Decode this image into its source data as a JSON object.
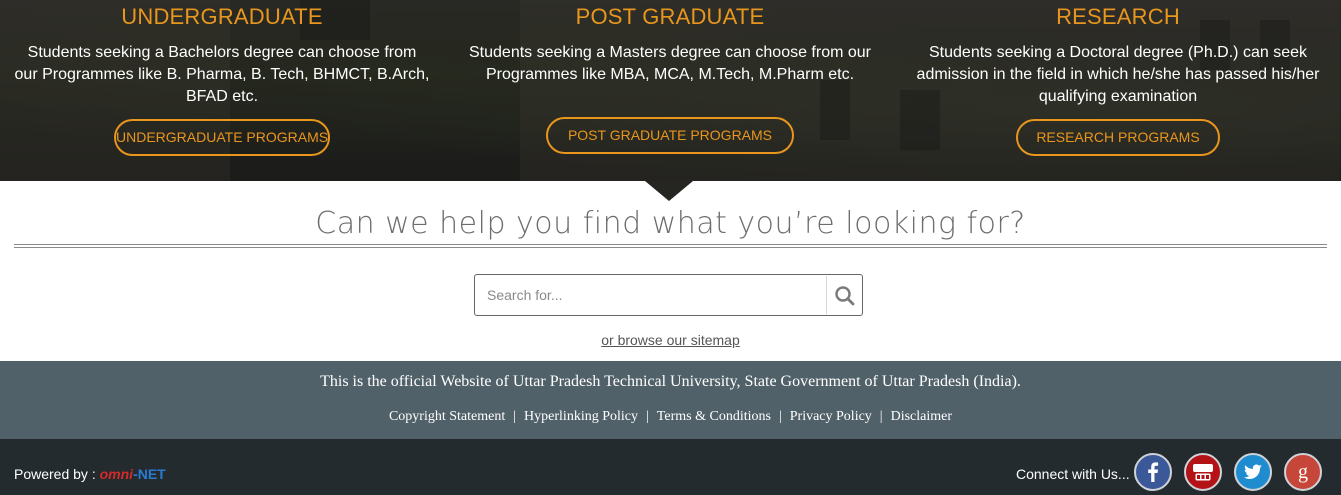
{
  "programs": {
    "undergraduate": {
      "title": "UNDERGRADUATE",
      "description": "Students seeking a Bachelors degree can choose from our Programmes like B. Pharma, B. Tech, BHMCT, B.Arch, BFAD etc.",
      "button": "UNDERGRADUATE PROGRAMS"
    },
    "postgraduate": {
      "title": "POST GRADUATE",
      "description": "Students seeking a Masters degree can choose from our Programmes like MBA, MCA, M.Tech, M.Pharm etc.",
      "button": "POST GRADUATE PROGRAMS"
    },
    "research": {
      "title": "RESEARCH",
      "description": "Students seeking a Doctoral degree (Ph.D.) can seek admission in the field in which he/she has passed his/her qualifying examination",
      "button": "RESEARCH PROGRAMS"
    }
  },
  "help": {
    "title": "Can we help you find what you’re looking for?",
    "search_placeholder": "Search for...",
    "search_value": "",
    "sitemap_link": "or browse our sitemap"
  },
  "footer": {
    "official_text": "This is the official Website of Uttar Pradesh Technical University, State Government of Uttar Pradesh (India).",
    "links": [
      "Copyright Statement",
      "Hyperlinking Policy",
      "Terms & Conditions",
      "Privacy Policy",
      "Disclaimer"
    ],
    "separator": "|"
  },
  "bottom": {
    "powered_label": "Powered by :",
    "brand_part1": "omni",
    "brand_part2": "-NET",
    "connect_label": "Connect with Us...",
    "social": [
      "facebook-icon",
      "youtube-icon",
      "twitter-icon",
      "google-plus-icon"
    ]
  },
  "colors": {
    "accent": "#e8961e",
    "footer_band": "#516169",
    "bottom_bar": "#232b2f",
    "facebook": "#3b5998",
    "youtube": "#b31217",
    "twitter": "#1f8ccf",
    "google_plus": "#c6463a"
  }
}
